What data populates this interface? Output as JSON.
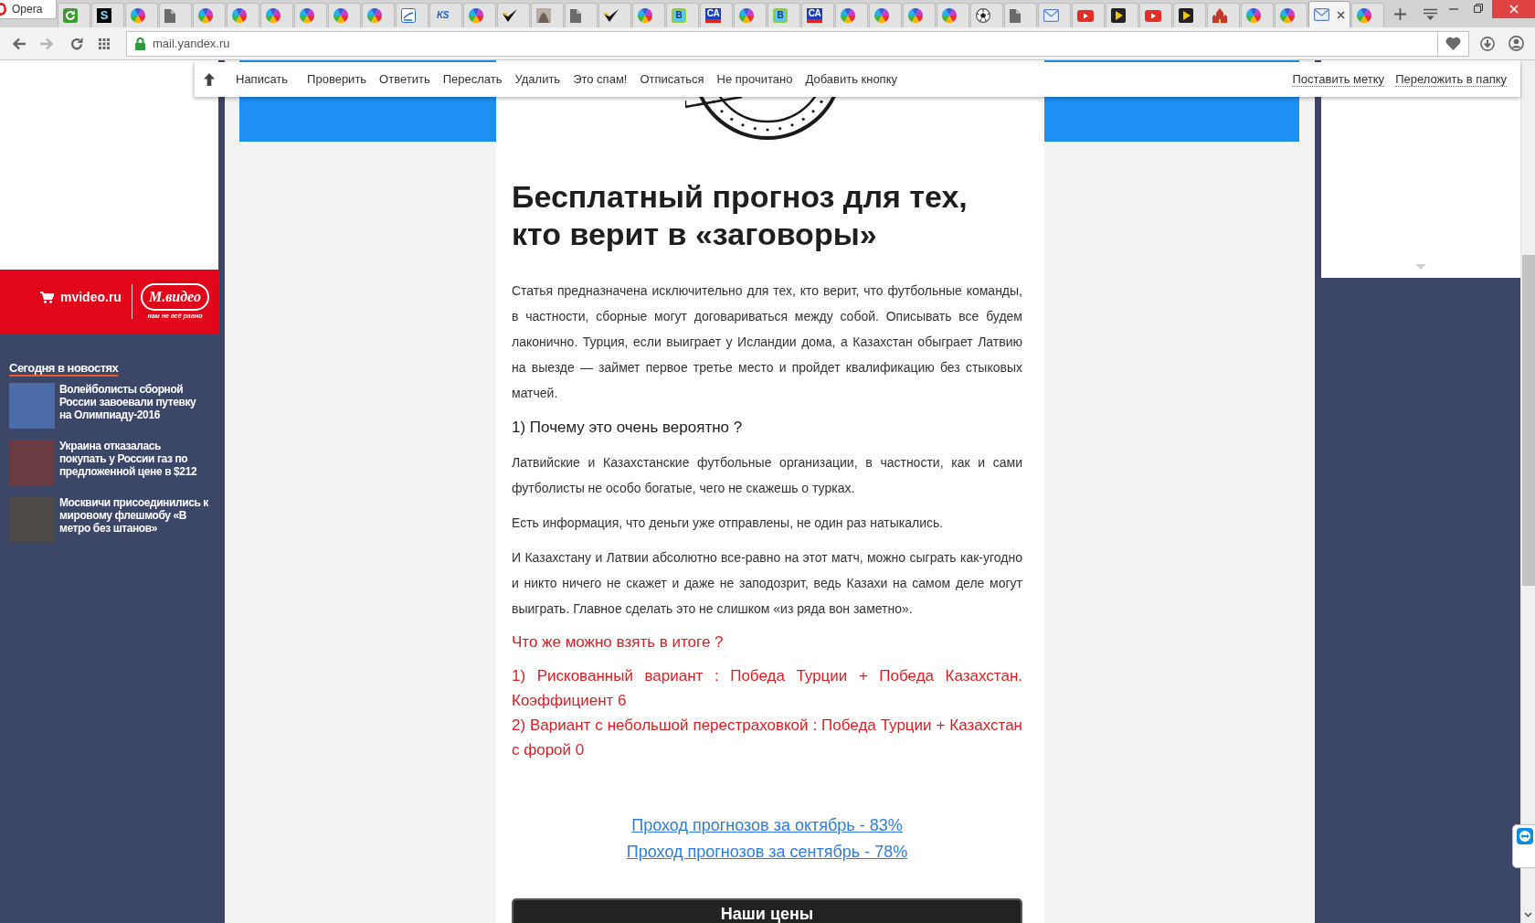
{
  "browser": {
    "menu_button": "Opera",
    "tabs": [
      {
        "kind": "refresh",
        "selected": false
      },
      {
        "kind": "s_square",
        "label": "S",
        "selected": false
      },
      {
        "kind": "wheel",
        "selected": false
      },
      {
        "kind": "doc",
        "selected": false
      },
      {
        "kind": "wheel",
        "selected": false
      },
      {
        "kind": "wheel",
        "selected": false
      },
      {
        "kind": "wheel",
        "selected": false
      },
      {
        "kind": "wheel",
        "selected": false
      },
      {
        "kind": "wheel",
        "selected": false
      },
      {
        "kind": "wheel",
        "selected": false
      },
      {
        "kind": "page",
        "selected": false
      },
      {
        "kind": "ks",
        "label": "KS",
        "selected": false
      },
      {
        "kind": "wheel",
        "selected": false
      },
      {
        "kind": "check",
        "selected": false
      },
      {
        "kind": "photo",
        "selected": false
      },
      {
        "kind": "doc",
        "selected": false
      },
      {
        "kind": "check",
        "selected": false
      },
      {
        "kind": "wheel",
        "selected": false
      },
      {
        "kind": "b_square",
        "label": "B",
        "selected": false
      },
      {
        "kind": "ca",
        "label": "CA",
        "selected": false
      },
      {
        "kind": "wheel",
        "selected": false
      },
      {
        "kind": "b_square",
        "label": "B",
        "selected": false
      },
      {
        "kind": "ca",
        "label": "CA",
        "selected": false
      },
      {
        "kind": "wheel",
        "selected": false
      },
      {
        "kind": "wheel",
        "selected": false
      },
      {
        "kind": "wheel",
        "selected": false
      },
      {
        "kind": "wheel",
        "selected": false
      },
      {
        "kind": "ball",
        "selected": false
      },
      {
        "kind": "doc",
        "selected": false
      },
      {
        "kind": "mail",
        "selected": false
      },
      {
        "kind": "video",
        "selected": false
      },
      {
        "kind": "play",
        "selected": false
      },
      {
        "kind": "video",
        "selected": false
      },
      {
        "kind": "play",
        "selected": false
      },
      {
        "kind": "castle",
        "selected": false
      },
      {
        "kind": "wheel",
        "selected": false
      },
      {
        "kind": "wheel",
        "selected": false
      },
      {
        "kind": "mail",
        "selected": true
      },
      {
        "kind": "wheel",
        "selected": false
      }
    ],
    "navigation": {
      "forward_disabled": true
    },
    "address": "mail.yandex.ru"
  },
  "mail_toolbar": {
    "actions": [
      "Написать",
      "Проверить",
      "Ответить",
      "Переслать",
      "Удалить",
      "Это спам!",
      "Отписаться",
      "Не прочитано",
      "Добавить кнопку"
    ],
    "folder_actions": [
      "Поставить метку",
      "Переложить в папку"
    ]
  },
  "left_sidebar": {
    "banner": {
      "site": "mvideo.ru",
      "logo": "М.видео",
      "slogan": "нам не всё равно"
    },
    "news_heading": "Сегодня в новостях",
    "news": [
      {
        "title": "Волейболисты сборной России завоевали путевку на Олимпиаду-2016"
      },
      {
        "title": "Украина отказалась покупать у России газ по предложенной цене в $212"
      },
      {
        "title": "Москвичи присоединились к мировому флешмобу «В метро без штанов»"
      }
    ]
  },
  "email": {
    "title": "Бесплатный прогноз для тех, кто верит в «заговоры»",
    "blocks": [
      {
        "kind": "paragraph",
        "text": "Статья предназначена исключительно для тех, кто верит, что футбольные команды, в частности, сборные могут договариваться между собой. Описывать все будем лаконично. Турция, если выиграет у Исландии дома, а Казахстан обыграет Латвию на выезде — займет первое третье место и пройдет квалификацию без стыковых матчей."
      },
      {
        "kind": "subheading",
        "text": "1) Почему это очень вероятно ?"
      },
      {
        "kind": "paragraph",
        "text": "Латвийские и Казахстанские футбольные организации, в частности, как и сами футболисты не особо богатые, чего не скажешь о турках."
      },
      {
        "kind": "paragraph",
        "text": "Есть информация, что деньги уже отправлены, не один раз натыкались."
      },
      {
        "kind": "paragraph",
        "text": "И Казахстану и Латвии абсолютно все-равно на этот матч, можно сыграть как-угодно и никто ничего не скажет и даже не заподозрит, ведь Казахи на самом деле могут выиграть. Главное сделать это не слишком «из ряда вон заметно»."
      },
      {
        "kind": "highlight_heading",
        "text": "Что же можно взять в итоге ?"
      },
      {
        "kind": "highlight",
        "text": "1) Рискованный вариант : Победа Турции + Победа Казахстан. Коэффициент 6"
      },
      {
        "kind": "highlight",
        "text": "2) Вариант с небольшой перестраховкой : Победа Турции + Казахстан с форой 0"
      },
      {
        "kind": "link",
        "text": "Проход прогнозов за октябрь - 83%"
      },
      {
        "kind": "link",
        "text": "Проход прогнозов за сентябрь - 78%"
      }
    ],
    "button": "Наши цены"
  }
}
